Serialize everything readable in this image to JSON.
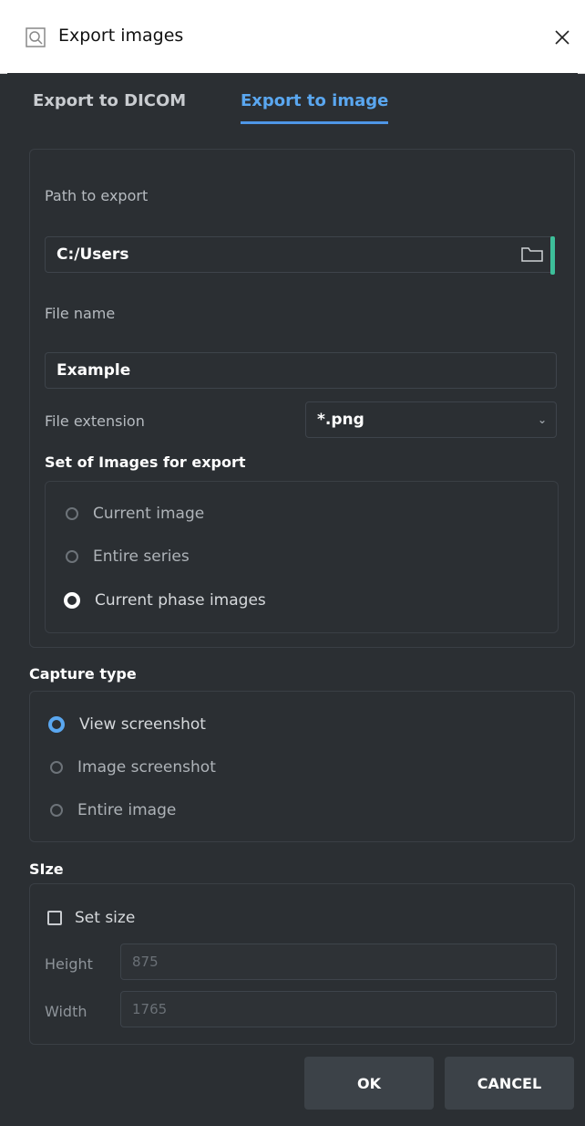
{
  "window": {
    "title": "Export images",
    "close_icon": "close-icon",
    "app_icon": "search-image-icon"
  },
  "tabs": [
    {
      "label": "Export to DICOM",
      "active": false
    },
    {
      "label": "Export to image",
      "active": true
    }
  ],
  "export": {
    "path_label": "Path to export",
    "path_value": "C:/Users",
    "folder_icon": "folder-icon",
    "file_name_label": "File name",
    "file_name_value": "Example",
    "file_ext_label": "File extension",
    "file_ext_value": "*.png"
  },
  "image_set": {
    "title": "Set of Images for export",
    "options": [
      "Current image",
      "Entire series",
      "Current phase images"
    ],
    "selected": "Current phase images"
  },
  "capture": {
    "title": "Capture type",
    "options": [
      "View screenshot",
      "Image screenshot",
      "Entire image"
    ],
    "selected": "View screenshot"
  },
  "size": {
    "title": "SIze",
    "set_size_label": "Set size",
    "set_size_checked": false,
    "height_label": "Height",
    "height_placeholder": "875",
    "width_label": "Width",
    "width_placeholder": "1765"
  },
  "buttons": {
    "ok": "OK",
    "cancel": "CANCEL"
  },
  "colors": {
    "accent": "#5aa7f0",
    "background": "#2b2f33",
    "button": "#3c4248",
    "scroll_accent": "#3dbf9a"
  }
}
